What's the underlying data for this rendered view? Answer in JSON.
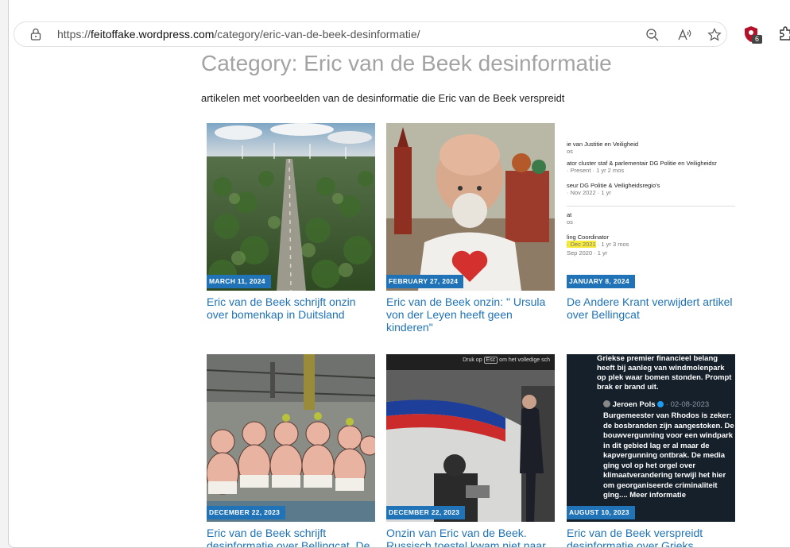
{
  "browser": {
    "url_scheme": "https://",
    "url_domain": "feitoffake.wordpress.com",
    "url_path": "/category/eric-van-de-beek-desinformatie/",
    "extension_badge": "6",
    "icons": [
      "lock-icon",
      "zoom-out-icon",
      "read-aloud-icon",
      "favorite-star-icon",
      "shield-extension-icon",
      "extensions-puzzle-icon"
    ]
  },
  "page": {
    "title": "Category: Eric van de Beek desinformatie",
    "description": "artikelen met voorbeelden van de desinformatie die Eric van de Beek verspreidt"
  },
  "posts": [
    {
      "date": "MARCH 11, 2024",
      "title": "Eric van de Beek schrijft onzin over bomenkap in Duitsland"
    },
    {
      "date": "FEBRUARY 27, 2024",
      "title": "Eric van de Beek onzin: \" Ursula von der Leyen heeft geen kinderen\""
    },
    {
      "date": "JANUARY 8, 2024",
      "title": "De Andere Krant verwijdert artikel over Bellingcat"
    },
    {
      "date": "DECEMBER 22, 2023",
      "title": "Eric van de Beek schrijft desinformatie over Bellingcat. De"
    },
    {
      "date": "DECEMBER 22, 2023",
      "title": "Onzin van Eric van de Beek. Russisch toestel kwam niet naar"
    },
    {
      "date": "AUGUST 10, 2023",
      "title": "Eric van de Beek verspreidt desinformatie over Grieks"
    }
  ],
  "thumb_linkedin": {
    "lines": [
      "ie van Justitie en Veiligheid",
      "os",
      "ator cluster staf & parlementair DG Politie en Veiligheidsr",
      "· Present · 1 yr 2 mos",
      "seur DG Politie & Veiligheidsregio's",
      "· Nov 2022 · 1 yr",
      "at",
      "os",
      "ling Coordinator",
      "· Dec 2021",
      "· 1 yr 3 mos",
      "Sep 2020 · 1 yr"
    ]
  },
  "thumb_video": {
    "caption_prefix": "Druk op",
    "caption_key": "Esc",
    "caption_suffix": "om het volledige sch"
  },
  "thumb_tweet": {
    "quote": "Griekse premier financieel belang heeft bij aanleg van windmolenpark op plek waar bomen stonden. Prompt brak er brand uit.",
    "author": "Jeroen Pols",
    "date": "· 02-08-2023",
    "body": "Burgemeester van Rhodos is zeker: de bosbranden zijn aangestoken. De bouwvergunning voor een windpark in dit gebied lag er al maar de kapvergunning ontbrak. De media ging vol op het orgel over klimaatverandering terwijl het hier om georganiseerde criminaliteit ging.... Meer informatie"
  },
  "colors": {
    "accent": "#1f73b6",
    "title_gray": "#a3a3a3"
  }
}
